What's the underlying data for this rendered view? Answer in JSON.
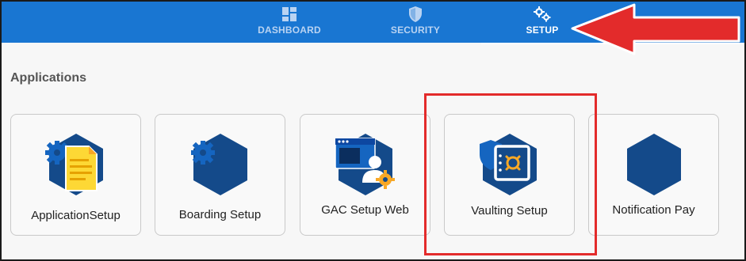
{
  "nav": {
    "items": [
      {
        "label": "DASHBOARD",
        "icon": "dashboard-grid-icon"
      },
      {
        "label": "SECURITY",
        "icon": "shield-icon"
      },
      {
        "label": "SETUP",
        "icon": "gears-icon"
      }
    ],
    "active": "SETUP"
  },
  "section": {
    "title": "Applications"
  },
  "applications": [
    {
      "label": "ApplicationSetup",
      "icon": "application-setup-icon"
    },
    {
      "label": "Boarding Setup",
      "icon": "boarding-setup-icon"
    },
    {
      "label": "GAC Setup Web",
      "icon": "gac-setup-web-icon"
    },
    {
      "label": "Vaulting Setup",
      "icon": "vaulting-setup-icon"
    },
    {
      "label": "Notification Pay",
      "icon": "notification-pay-icon"
    }
  ],
  "colors": {
    "topbar": "#1976d2",
    "hexagon": "#144a8a",
    "gear": "#1565c0",
    "document": "#fdd835",
    "annotation": "#e32b2b"
  }
}
